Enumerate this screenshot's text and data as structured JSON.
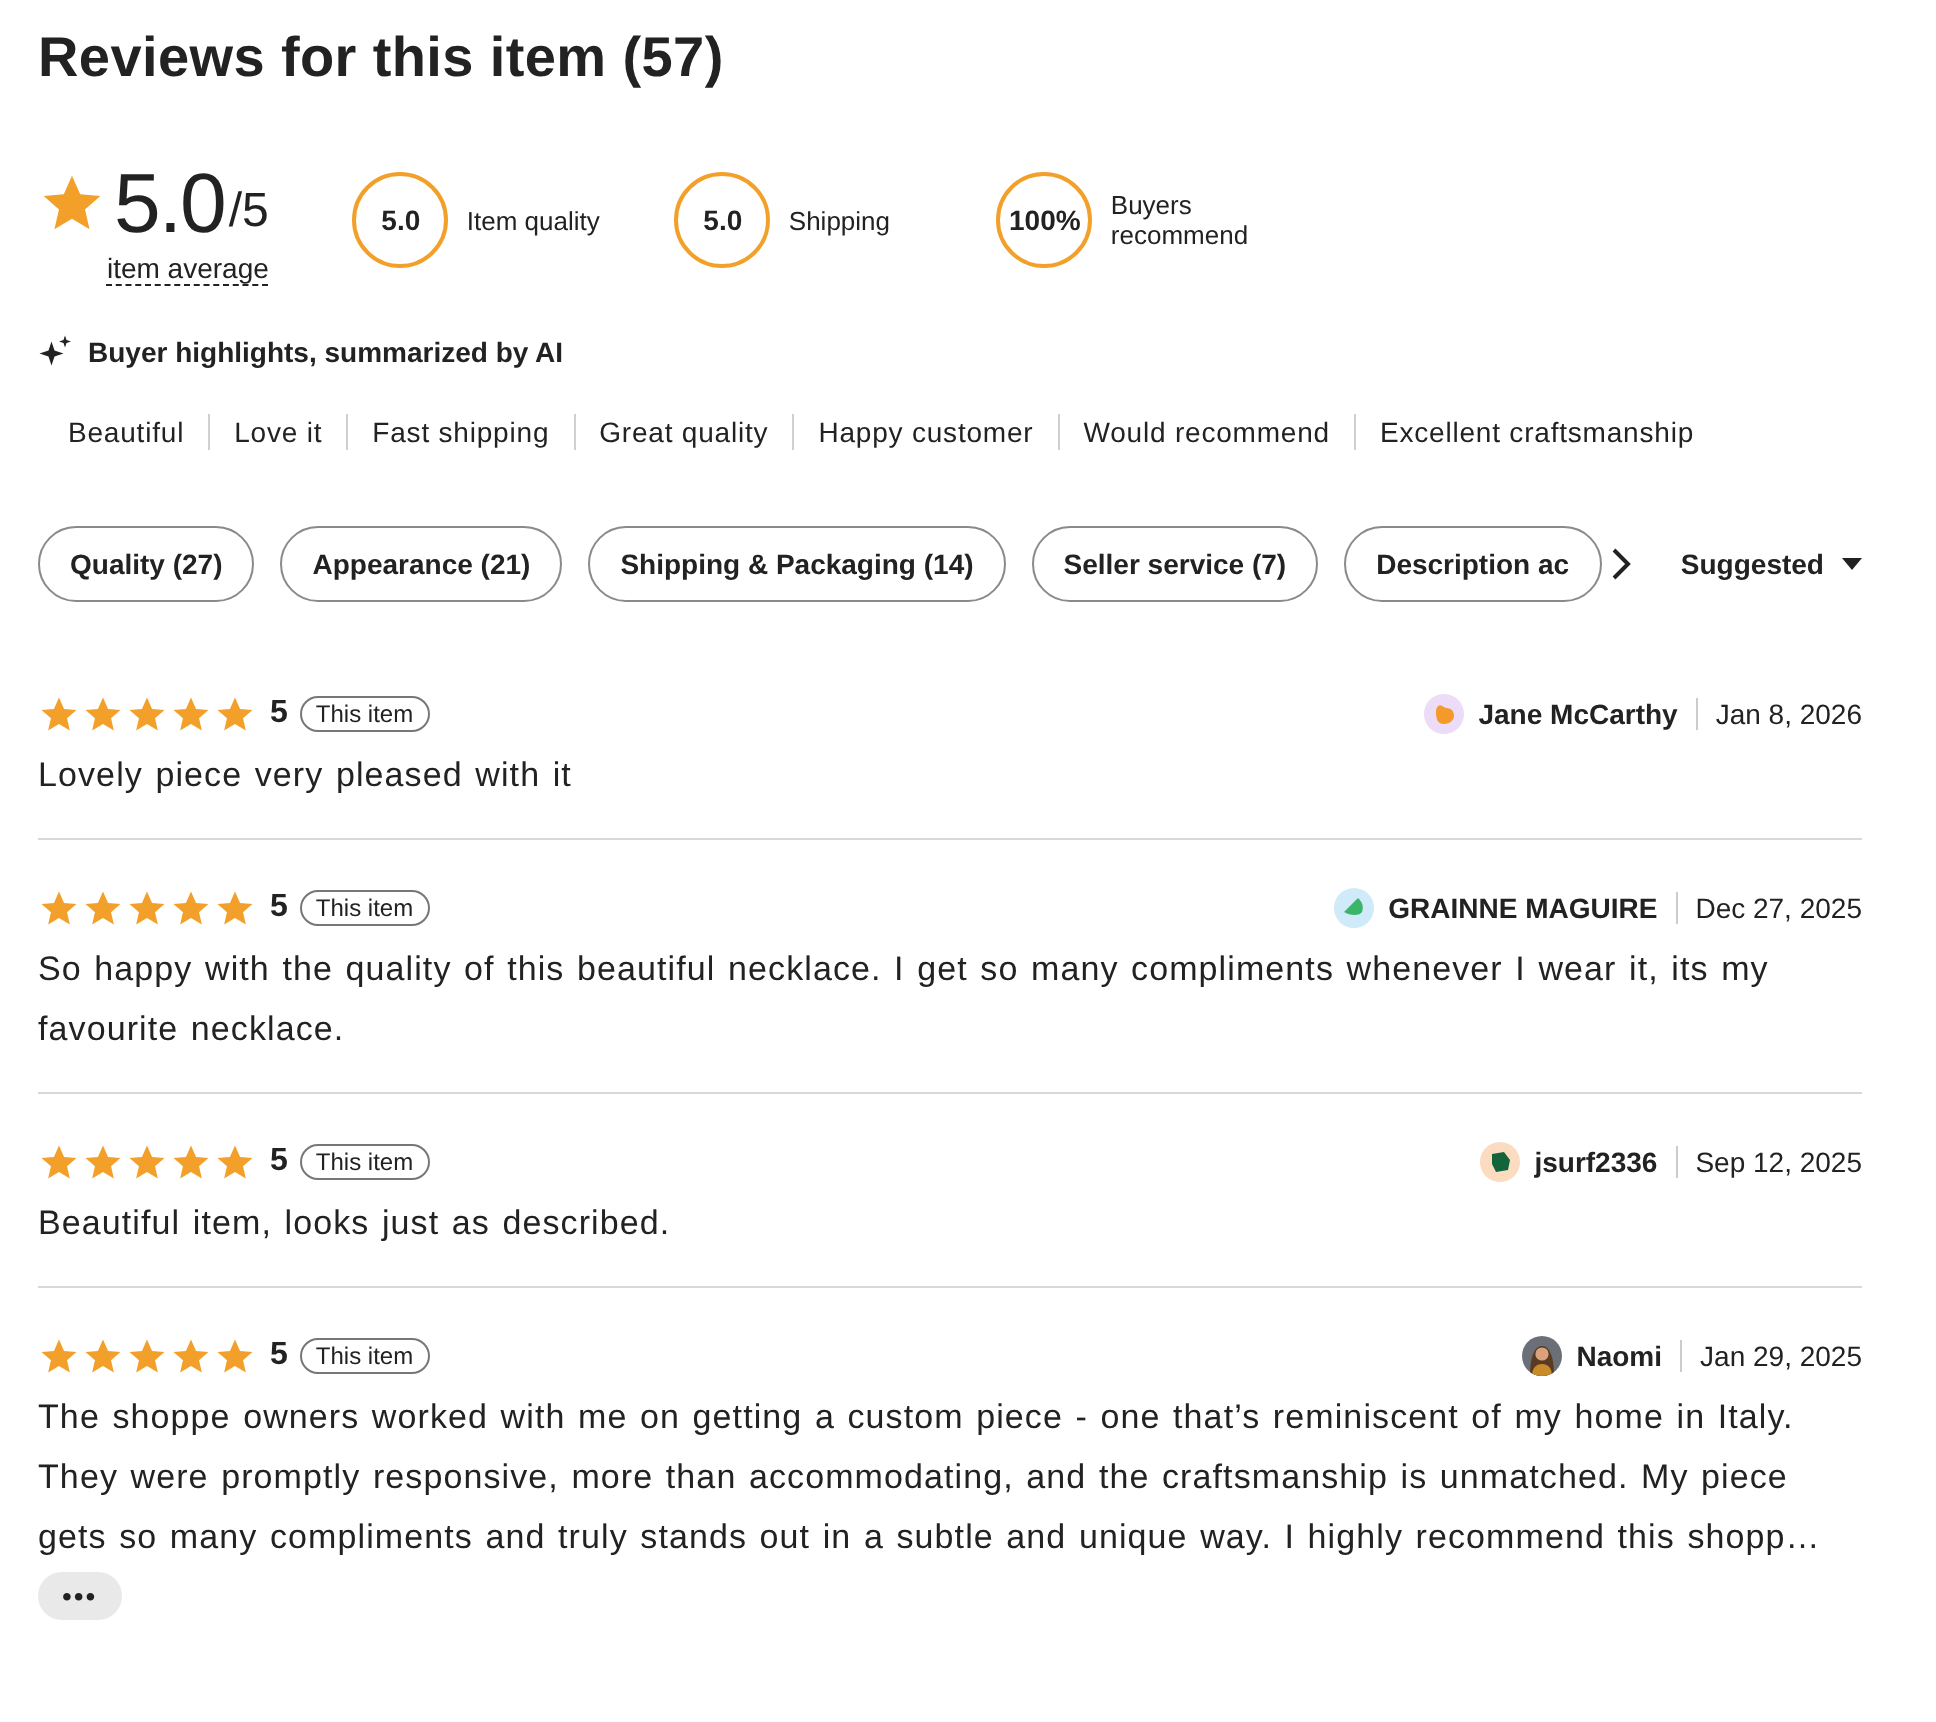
{
  "title": "Reviews for this item (57)",
  "summary": {
    "score": "5.0",
    "out_of": "/5",
    "caption": "item average",
    "metrics": [
      {
        "value": "5.0",
        "label": "Item quality"
      },
      {
        "value": "5.0",
        "label": "Shipping"
      },
      {
        "value": "100%",
        "label": "Buyers recommend"
      }
    ]
  },
  "highlights": {
    "heading": "Buyer highlights, summarized by AI",
    "tags": [
      "Beautiful",
      "Love it",
      "Fast shipping",
      "Great quality",
      "Happy customer",
      "Would recommend",
      "Excellent craftsmanship"
    ]
  },
  "filters": [
    "Quality (27)",
    "Appearance (21)",
    "Shipping & Packaging (14)",
    "Seller service (7)",
    "Description ac"
  ],
  "sort": {
    "label": "Suggested"
  },
  "reviews": [
    {
      "stars": 5,
      "rating": "5",
      "badge": "This item",
      "reviewer": "Jane McCarthy",
      "date": "Jan 8, 2026",
      "avatar": {
        "kind": "blob"
      },
      "text": "Lovely piece very pleased with it"
    },
    {
      "stars": 5,
      "rating": "5",
      "badge": "This item",
      "reviewer": "GRAINNE MAGUIRE",
      "date": "Dec 27, 2025",
      "avatar": {
        "kind": "leaf"
      },
      "text": "So happy with the quality of this beautiful necklace. I get so many compliments whenever I wear it, its my favourite necklace."
    },
    {
      "stars": 5,
      "rating": "5",
      "badge": "This item",
      "reviewer": "jsurf2336",
      "date": "Sep 12, 2025",
      "avatar": {
        "kind": "hex"
      },
      "text": "Beautiful item, looks just as described."
    },
    {
      "stars": 5,
      "rating": "5",
      "badge": "This item",
      "reviewer": "Naomi",
      "date": "Jan 29, 2025",
      "text": "The shoppe owners worked with me on getting a custom piece - one that’s reminiscent of my home in Italy. They were promptly responsive, more than accommodating, and the craftsmanship is unmatched. My piece gets so many compliments and truly stands out in a subtle and unique way. I highly recommend this shopp…",
      "more": "•••"
    }
  ]
}
